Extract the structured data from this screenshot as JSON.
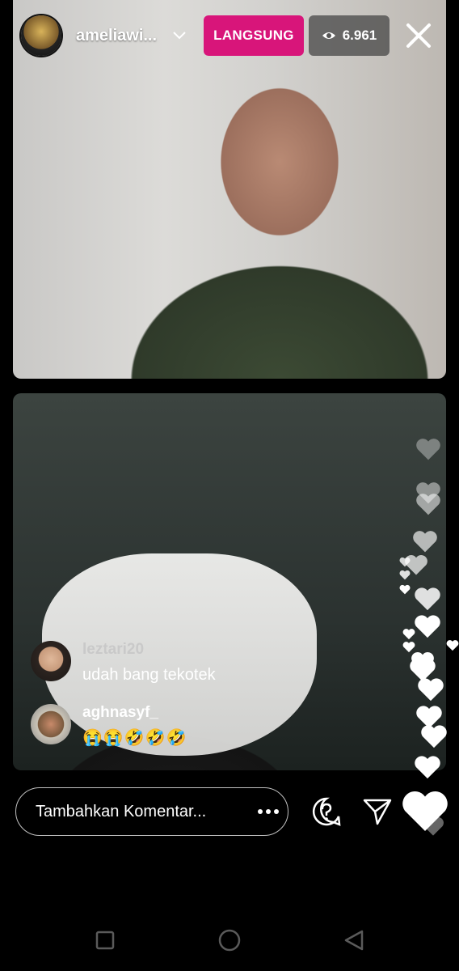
{
  "header": {
    "username": "ameliawi...",
    "live_label": "LANGSUNG",
    "viewer_count": "6.961"
  },
  "comments": [
    {
      "user": "leztari20",
      "text": "udah bang tekotek"
    },
    {
      "user": "aghnasyf_",
      "text": "😭😭🤣🤣🤣"
    }
  ],
  "input": {
    "placeholder": "Tambahkan Komentar..."
  },
  "colors": {
    "live_badge": "#d8157a",
    "background": "#000000"
  },
  "icons": [
    "chevron-down-icon",
    "eye-icon",
    "close-icon",
    "more-icon",
    "question-icon",
    "send-icon",
    "heart-icon",
    "recent-apps-icon",
    "home-icon",
    "back-icon"
  ]
}
